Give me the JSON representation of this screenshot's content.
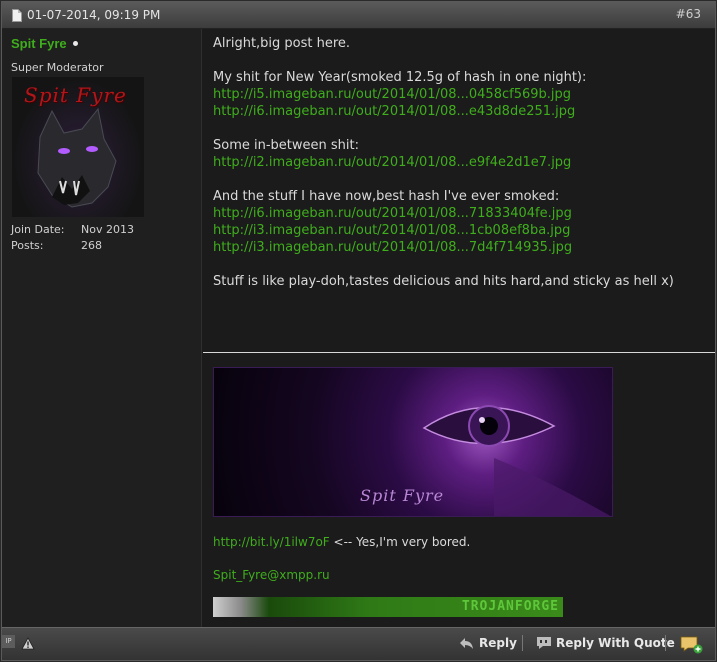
{
  "post": {
    "date": "01-07-2014, 09:19 PM",
    "number": "#63"
  },
  "user": {
    "name": "Spit Fyre",
    "title": "Super Moderator",
    "avatar_text": "Spit Fyre",
    "join_label": "Join Date:",
    "join_value": "Nov 2013",
    "posts_label": "Posts:",
    "posts_value": "268"
  },
  "message": {
    "line1": "Alright,big post here.",
    "line2": "My shit for New Year(smoked 12.5g of hash in one night):",
    "link1": "http://i5.imageban.ru/out/2014/01/08...0458cf569b.jpg",
    "link2": "http://i6.imageban.ru/out/2014/01/08...e43d8de251.jpg",
    "line3": "Some in-between shit:",
    "link3": "http://i2.imageban.ru/out/2014/01/08...e9f4e2d1e7.jpg",
    "line4": "And the stuff I have now,best hash I've ever smoked:",
    "link4": "http://i6.imageban.ru/out/2014/01/08...71833404fe.jpg",
    "link5": "http://i3.imageban.ru/out/2014/01/08...1cb08ef8ba.jpg",
    "link6": "http://i3.imageban.ru/out/2014/01/08...7d4f714935.jpg",
    "line5": "Stuff is like play-doh,tastes delicious and hits hard,and sticky as hell x)"
  },
  "signature": {
    "banner_text": "Spit Fyre",
    "short_link": "http://bit.ly/1ilw7oF",
    "short_link_note": " <-- Yes,I'm very bored.",
    "contact": "Spit_Fyre@xmpp.ru",
    "bar_text": "TROJANFORGE"
  },
  "footer": {
    "ip_label": "IP",
    "reply": "Reply",
    "reply_quote": "Reply With Quote"
  },
  "colors": {
    "link": "#3fae1c",
    "background": "#1b1b1b",
    "header": "#4c4c4c"
  }
}
